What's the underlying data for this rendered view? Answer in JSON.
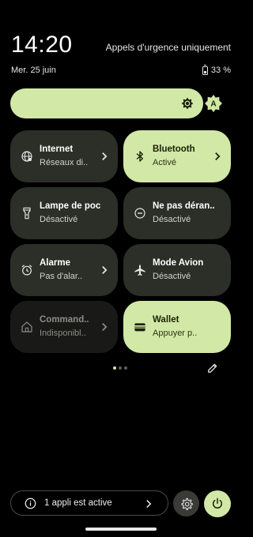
{
  "status": {
    "time": "14:20",
    "network_text": "Appels d'urgence uniquement",
    "date": "Mer. 25 juin",
    "battery_percent": "33 %",
    "battery_level": 0.33
  },
  "brightness": {
    "level": 0.87,
    "auto_badge": "A",
    "sun_icon": "brightness-icon",
    "auto_icon": "auto-brightness-icon"
  },
  "tiles": [
    {
      "title": "Internet",
      "subtitle": "Réseaux di..",
      "icon": "globe-icon",
      "state": "inactive",
      "chevron": true
    },
    {
      "title": "Bluetooth",
      "subtitle": "Activé",
      "icon": "bluetooth-icon",
      "state": "active",
      "chevron": true
    },
    {
      "title": "Lampe de poc..",
      "subtitle": "Désactivé",
      "icon": "flashlight-icon",
      "state": "inactive",
      "chevron": false
    },
    {
      "title": "Ne pas déran..",
      "subtitle": "Désactivé",
      "icon": "do-not-disturb-icon",
      "state": "inactive",
      "chevron": false
    },
    {
      "title": "Alarme",
      "subtitle": "Pas d'alar..",
      "icon": "alarm-icon",
      "state": "inactive",
      "chevron": true
    },
    {
      "title": "Mode Avion",
      "subtitle": "Désactivé",
      "icon": "airplane-icon",
      "state": "inactive",
      "chevron": false
    },
    {
      "title": "Command..",
      "subtitle": "Indisponibl..",
      "icon": "home-icon",
      "state": "unavailable",
      "chevron": true
    },
    {
      "title": "Wallet",
      "subtitle": "Appuyer p..",
      "icon": "wallet-icon",
      "state": "active",
      "chevron": false
    }
  ],
  "pager": {
    "pages": 3,
    "current": 1
  },
  "footer": {
    "notification_text": "1 appli est active",
    "info_icon": "info-icon",
    "settings_icon": "gear-icon",
    "power_icon": "power-icon"
  },
  "colors": {
    "accent": "#d2e8a6",
    "tile_bg": "#2c2e28",
    "background": "#000000"
  }
}
